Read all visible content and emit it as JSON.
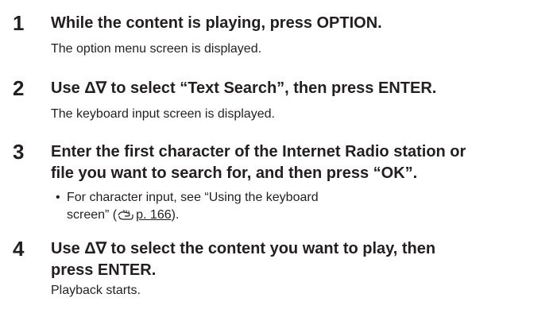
{
  "steps": [
    {
      "number": "1",
      "title": "While the content is playing, press OPTION.",
      "description": "The option menu screen is displayed."
    },
    {
      "number": "2",
      "title": "Use Δ∇ to select “Text Search”, then press ENTER.",
      "description": "The keyboard input screen is displayed."
    },
    {
      "number": "3",
      "title_line1": "Enter the first character of the Internet Radio station or",
      "title_line2": "file you want to search for, and then press “OK”.",
      "bullet": {
        "symbol": "•",
        "line1": "For character input, see “Using the keyboard",
        "line2_start": "screen” (",
        "ref_icon": "page-reference-icon",
        "ref_text": "p. 166",
        "line2_end": ")."
      }
    },
    {
      "number": "4",
      "title_line1": "Use Δ∇ to select the content you want to play, then",
      "title_line2": "press ENTER.",
      "description": "Playback starts."
    }
  ]
}
